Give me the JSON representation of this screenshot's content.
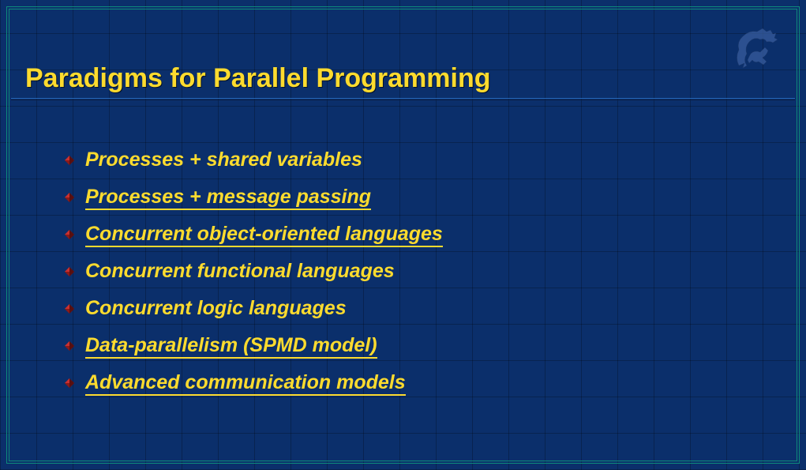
{
  "title": "Paradigms for Parallel Programming",
  "items": [
    {
      "label": "Processes + shared variables",
      "underlined": false
    },
    {
      "label": "Processes + message passing",
      "underlined": true
    },
    {
      "label": "Concurrent object-oriented languages",
      "underlined": true
    },
    {
      "label": "Concurrent functional languages",
      "underlined": false
    },
    {
      "label": "Concurrent logic languages",
      "underlined": false
    },
    {
      "label": "Data-parallelism (SPMD model)",
      "underlined": true
    },
    {
      "label": "Advanced communication models",
      "underlined": true
    }
  ],
  "colors": {
    "background": "#0b2f6b",
    "title": "#fddb2e",
    "border": "#0e8a7c",
    "bullet_fill": "#8b1a1a",
    "bullet_highlight": "#d44"
  }
}
